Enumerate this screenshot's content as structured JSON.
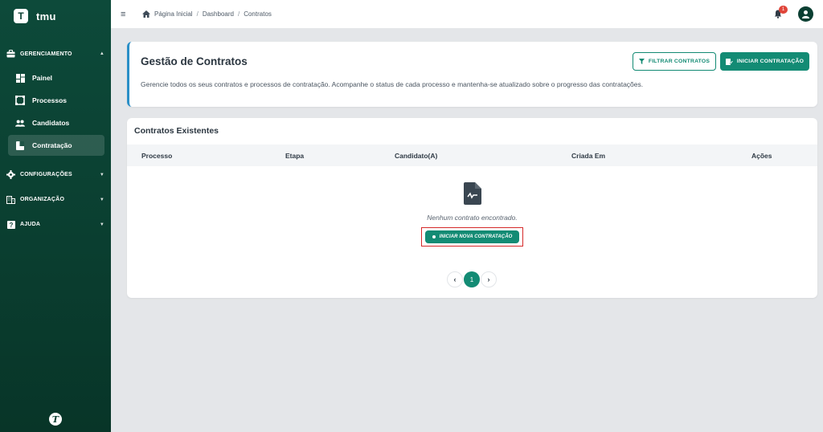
{
  "brand": {
    "initial": "T",
    "name": "tmu"
  },
  "sidebar": {
    "sections": [
      {
        "label": "GERENCIAMENTO",
        "icon": "briefcase-icon",
        "expanded": true
      },
      {
        "label": "CONFIGURAÇÕES",
        "icon": "gear-icon",
        "expanded": false
      },
      {
        "label": "ORGANIZAÇÃO",
        "icon": "building-icon",
        "expanded": false
      },
      {
        "label": "AJUDA",
        "icon": "help-icon",
        "expanded": false
      }
    ],
    "items": [
      {
        "label": "Painel",
        "icon": "dashboard-icon"
      },
      {
        "label": "Processos",
        "icon": "process-icon"
      },
      {
        "label": "Candidatos",
        "icon": "people-icon"
      },
      {
        "label": "Contratação",
        "icon": "contract-icon",
        "active": true
      }
    ],
    "footer_logo": "T"
  },
  "topbar": {
    "breadcrumb": [
      "Página Inicial",
      "Dashboard",
      "Contratos"
    ],
    "notification_count": "1"
  },
  "header": {
    "title": "Gestão de Contratos",
    "description": "Gerencie todos os seus contratos e processos de contratação. Acompanhe o status de cada processo e mantenha-se atualizado sobre o progresso das contratações.",
    "filter_button": "FILTRAR CONTRATOS",
    "start_button": "INICIAR CONTRATAÇÃO"
  },
  "contracts": {
    "title": "Contratos Existentes",
    "columns": [
      "Processo",
      "Etapa",
      "Candidato(A)",
      "Criada Em",
      "Ações"
    ],
    "empty_message": "Nenhum contrato encontrado.",
    "empty_button": "INICIAR NOVA CONTRATAÇÃO",
    "pagination": {
      "current_page": "1"
    }
  },
  "colors": {
    "brand": "#0b3f32",
    "accent": "#138b74",
    "highlight": "#d62a2a",
    "header_border": "#2a8fc7"
  }
}
